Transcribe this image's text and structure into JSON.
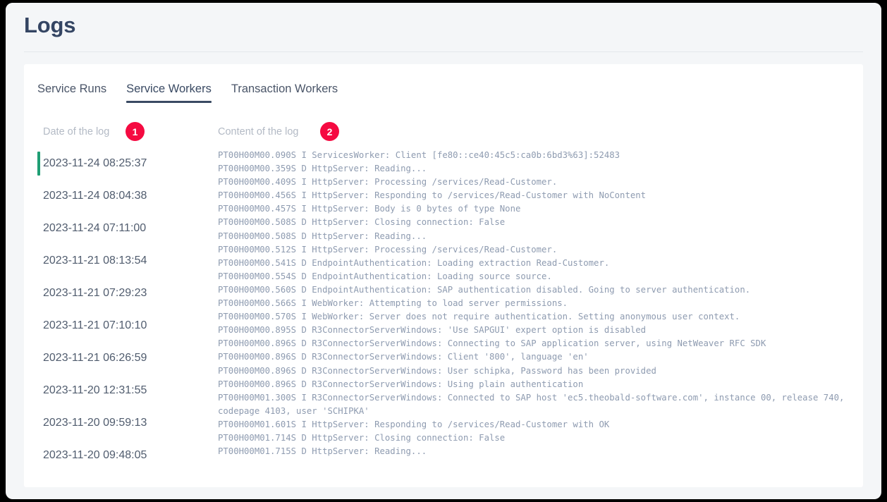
{
  "page": {
    "title": "Logs"
  },
  "tabs": [
    {
      "label": "Service Runs",
      "active": false
    },
    {
      "label": "Service Workers",
      "active": true
    },
    {
      "label": "Transaction Workers",
      "active": false
    }
  ],
  "columns": {
    "date_header": "Date of the log",
    "content_header": "Content of the log",
    "date_badge": "1",
    "content_badge": "2"
  },
  "colors": {
    "badge": "#f50a41",
    "selected_marker": "#1f9e74",
    "title": "#344563",
    "tab_active_underline": "#3a4a63",
    "log_text": "#8e9bb0",
    "page_background": "#f4f6f8",
    "card_background": "#ffffff"
  },
  "date_list": [
    {
      "date": "2023-11-24 08:25:37",
      "selected": true
    },
    {
      "date": "2023-11-24 08:04:38",
      "selected": false
    },
    {
      "date": "2023-11-24 07:11:00",
      "selected": false
    },
    {
      "date": "2023-11-21 08:13:54",
      "selected": false
    },
    {
      "date": "2023-11-21 07:29:23",
      "selected": false
    },
    {
      "date": "2023-11-21 07:10:10",
      "selected": false
    },
    {
      "date": "2023-11-21 06:26:59",
      "selected": false
    },
    {
      "date": "2023-11-20 12:31:55",
      "selected": false
    },
    {
      "date": "2023-11-20 09:59:13",
      "selected": false
    },
    {
      "date": "2023-11-20 09:48:05",
      "selected": false
    }
  ],
  "log_lines": [
    "PT00H00M00.090S I ServicesWorker: Client [fe80::ce40:45c5:ca0b:6bd3%63]:52483",
    "PT00H00M00.359S D HttpServer: Reading...",
    "PT00H00M00.409S I HttpServer: Processing /services/Read-Customer.",
    "PT00H00M00.456S I HttpServer: Responding to /services/Read-Customer with NoContent",
    "PT00H00M00.457S I HttpServer: Body is 0 bytes of type None",
    "PT00H00M00.508S D HttpServer: Closing connection: False",
    "PT00H00M00.508S D HttpServer: Reading...",
    "PT00H00M00.512S I HttpServer: Processing /services/Read-Customer.",
    "PT00H00M00.541S D EndpointAuthentication: Loading extraction Read-Customer.",
    "PT00H00M00.554S D EndpointAuthentication: Loading source source.",
    "PT00H00M00.560S D EndpointAuthentication: SAP authentication disabled. Going to server authentication.",
    "PT00H00M00.566S I WebWorker: Attempting to load server permissions.",
    "PT00H00M00.570S I WebWorker: Server does not require authentication. Setting anonymous user context.",
    "PT00H00M00.895S D R3ConnectorServerWindows: 'Use SAPGUI' expert option is disabled",
    "PT00H00M00.896S D R3ConnectorServerWindows: Connecting to SAP application server, using NetWeaver RFC SDK",
    "PT00H00M00.896S D R3ConnectorServerWindows: Client '800', language 'en'",
    "PT00H00M00.896S D R3ConnectorServerWindows: User schipka, Password has been provided",
    "PT00H00M00.896S D R3ConnectorServerWindows: Using plain authentication",
    "PT00H00M01.300S I R3ConnectorServerWindows: Connected to SAP host 'ec5.theobald-software.com', instance 00, release 740, codepage 4103, user 'SCHIPKA'",
    "PT00H00M01.601S I HttpServer: Responding to /services/Read-Customer with OK",
    "PT00H00M01.714S D HttpServer: Closing connection: False",
    "PT00H00M01.715S D HttpServer: Reading..."
  ]
}
